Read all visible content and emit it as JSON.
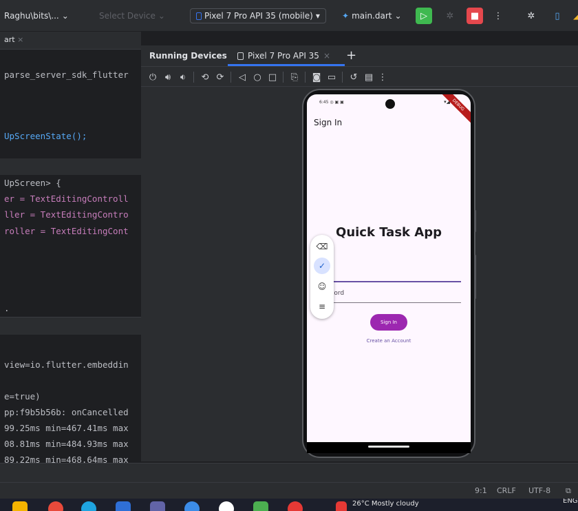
{
  "toolbar": {
    "project_path": "Raghu\\bits\\...",
    "select_device": "Select Device",
    "device": "Pixel 7 Pro API 35 (mobile)",
    "run_config": "main.dart",
    "accent_run": "#3fb950",
    "accent_stop": "#e5484d"
  },
  "editor": {
    "tab_label": "art",
    "lines": [
      "parse_server_sdk_flutter",
      "UpScreenState();",
      "UpScreen> {",
      "er = TextEditingControll",
      "ller = TextEditingContro",
      "roller = TextEditingCont",
      "."
    ]
  },
  "console": {
    "lines": [
      "view=io.flutter.embeddin",
      "e=true)",
      "pp:f9b5b56b: onCancelled",
      "99.25ms min=467.41ms max",
      "08.81ms min=484.93ms max",
      "89.22ms min=468.64ms max"
    ]
  },
  "running_devices": {
    "title": "Running Devices",
    "tab_label": "Pixel 7 Pro API 35"
  },
  "phone": {
    "status_time": "6:45",
    "debug_banner": "DEBUG",
    "app_bar_title": "Sign In",
    "headline": "Quick Task App",
    "password_label": "word",
    "sign_in_button": "Sign In",
    "create_account": "Create an Account",
    "button_color": "#9c27b0"
  },
  "statusbar": {
    "position": "9:1",
    "line_ending": "CRLF",
    "encoding": "UTF-8"
  },
  "taskbar": {
    "weather": "26°C Mostly cloudy",
    "language": "ENG"
  }
}
